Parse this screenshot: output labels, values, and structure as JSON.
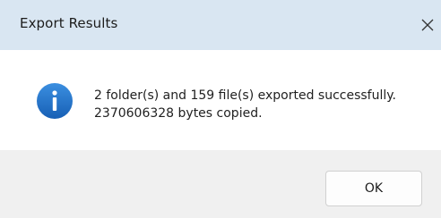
{
  "window": {
    "title": "Export Results",
    "close_icon": "close-icon"
  },
  "message": {
    "icon": "info-icon",
    "line1": "2 folder(s) and 159 file(s) exported successfully.",
    "line2": "2370606328 bytes copied."
  },
  "footer": {
    "ok_label": "OK"
  },
  "colors": {
    "titlebar_bg": "#d9e6f2",
    "info_blue": "#1f6fc8",
    "footer_bg": "#f0f0f0"
  }
}
